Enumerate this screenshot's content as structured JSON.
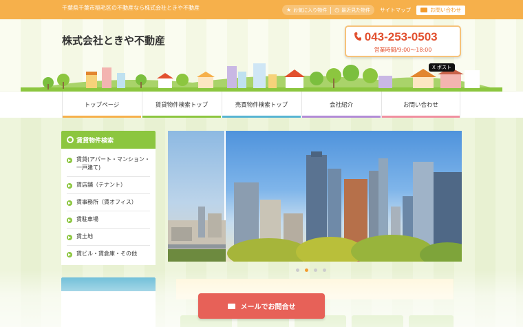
{
  "topbar": {
    "tagline": "千葉県千葉市稲毛区の不動産なら株式会社ときや不動産",
    "favorites": "お気に入り物件",
    "recent": "最近見た物件",
    "sitemap": "サイトマップ",
    "contact": "お問い合わせ"
  },
  "header": {
    "company": "株式会社ときや不動産",
    "phone": "043-253-0503",
    "hours": "営業時間/9:00〜18:00",
    "xpost": "X ポスト"
  },
  "nav": [
    {
      "label": "トップページ",
      "color": "#f6b04b"
    },
    {
      "label": "賃貸物件検索トップ",
      "color": "#8cc63f"
    },
    {
      "label": "売買物件検索トップ",
      "color": "#57b4d2"
    },
    {
      "label": "会社紹介",
      "color": "#b28bd6"
    },
    {
      "label": "お問い合わせ",
      "color": "#f08fa0"
    }
  ],
  "sidebar": {
    "title": "賃貸物件検索",
    "items": [
      "賃貸(アパート・マンション・一戸建て)",
      "賃店舗（テナント）",
      "賃事務所（賃オフィス）",
      "賃駐車場",
      "賃土地",
      "賃ビル・賃倉庫・その他"
    ]
  },
  "slider": {
    "total": 4,
    "active": 2
  },
  "cta": {
    "label": "メールでお問合せ"
  },
  "colors": {
    "accent": "#f6b04b",
    "green": "#8cc63f",
    "red": "#e2502f"
  }
}
